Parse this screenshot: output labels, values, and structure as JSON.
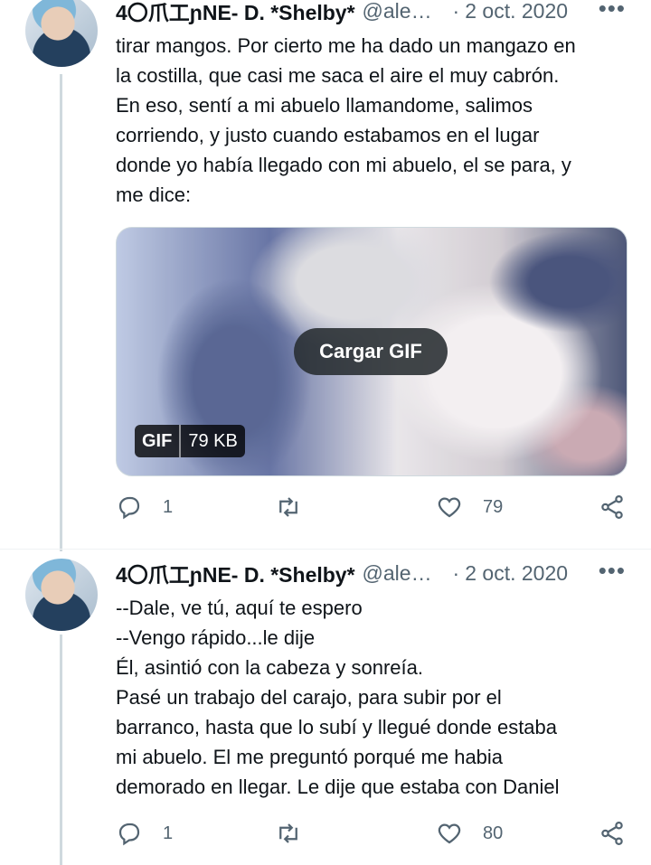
{
  "tweets": [
    {
      "author_name": "4〇爪工ɲNE- D. *Shelby*",
      "handle": "@alex…",
      "separator": "·",
      "time": "2 oct. 2020",
      "more": "•••",
      "text": "tirar mangos. Por cierto me ha dado un mangazo en\nla costilla, que casi me saca el aire el muy cabrón.\nEn eso, sentí a mi abuelo llamandome, salimos\ncorriendo, y justo cuando estabamos en el lugar\ndonde yo había llegado con mi abuelo, el se para, y\nme dice:",
      "media": {
        "load_label": "Cargar GIF",
        "badge_type": "GIF",
        "badge_size": "79 KB"
      },
      "replies": "1",
      "retweets": "",
      "likes": "79"
    },
    {
      "author_name": "4〇爪工ɲNE- D. *Shelby*",
      "handle": "@alex…",
      "separator": "·",
      "time": "2 oct. 2020",
      "more": "•••",
      "text": "--Dale, ve tú, aquí te espero\n--Vengo rápido...le dije\nÉl, asintió con la cabeza y sonreía.\nPasé un trabajo del carajo, para subir por el\nbarranco, hasta que lo subí y llegué donde estaba\nmi abuelo. El me preguntó porqué me habia\ndemorado en llegar. Le dije que estaba con Daniel",
      "replies": "1",
      "retweets": "",
      "likes": "80"
    }
  ],
  "icons": {
    "reply": "reply-icon",
    "retweet": "retweet-icon",
    "like": "heart-icon",
    "share": "share-icon",
    "more": "more-icon"
  },
  "colors": {
    "text": "#0f1419",
    "muted": "#536471",
    "border": "#cfd9de",
    "background": "#ffffff"
  }
}
